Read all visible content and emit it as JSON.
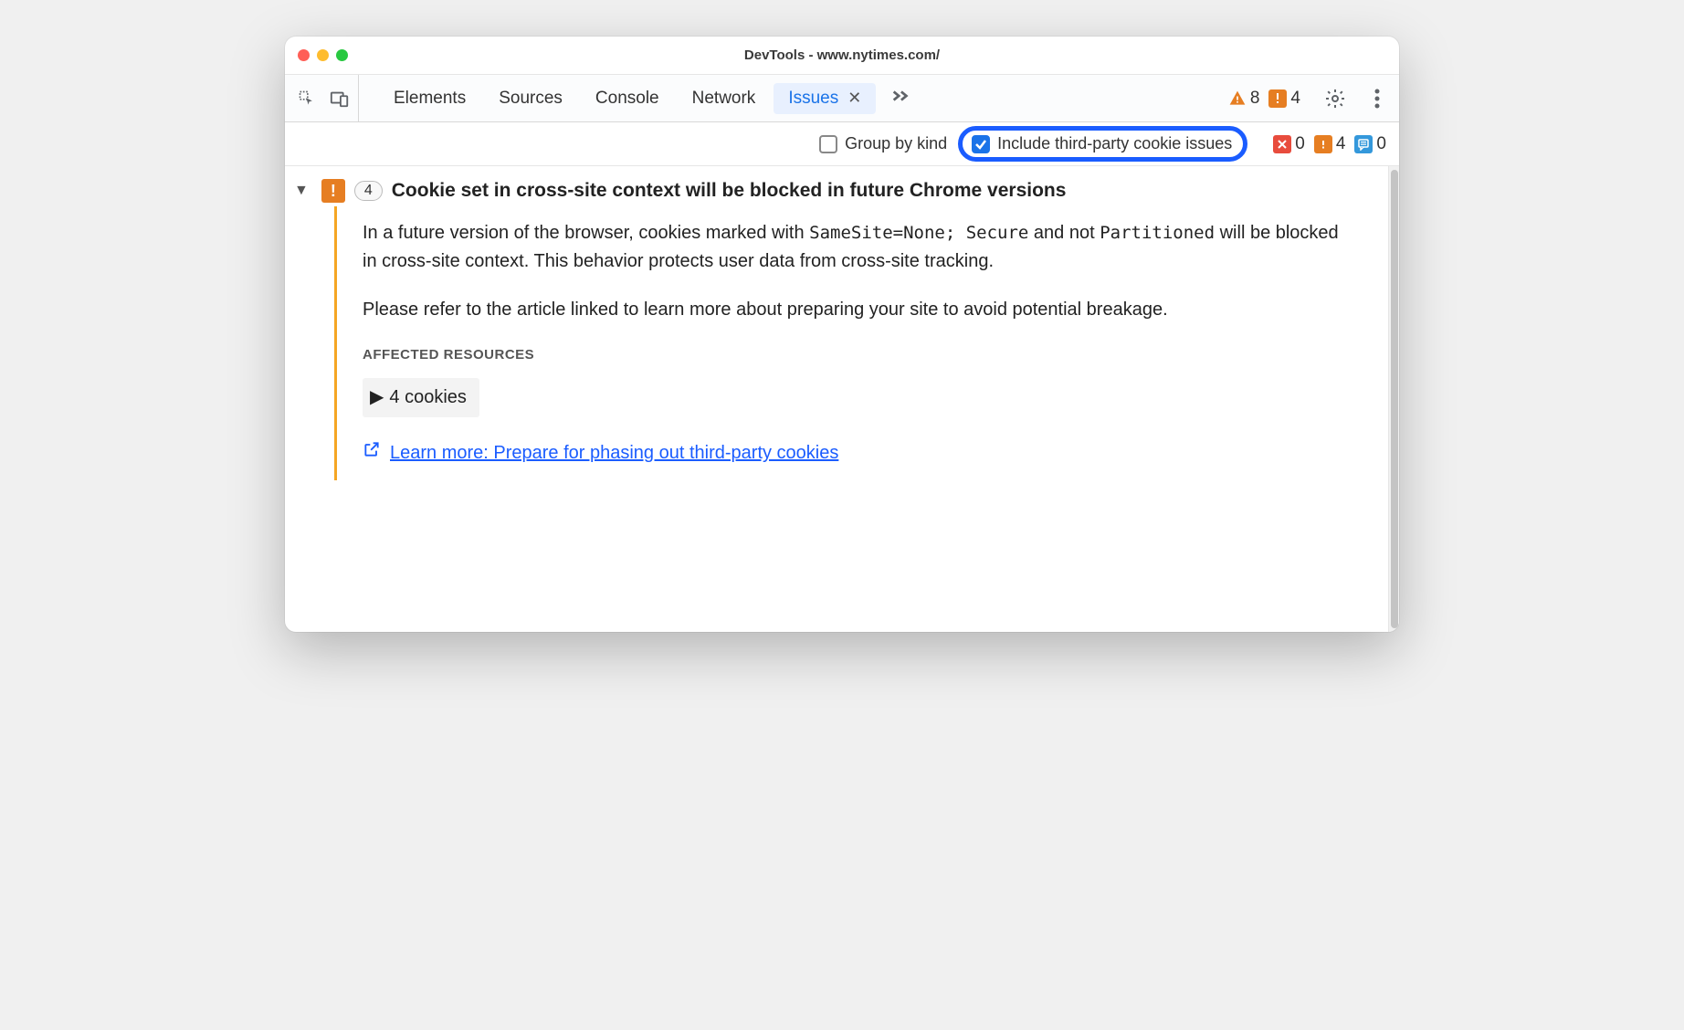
{
  "window": {
    "title": "DevTools - www.nytimes.com/"
  },
  "tabs": {
    "items": [
      "Elements",
      "Sources",
      "Console",
      "Network",
      "Issues"
    ],
    "active": "Issues"
  },
  "status": {
    "warning_count": "8",
    "issue_count": "4"
  },
  "filter": {
    "group_by_kind_label": "Group by kind",
    "include_tp_label": "Include third-party cookie issues"
  },
  "issue_counts": {
    "errors": "0",
    "warnings": "4",
    "info": "0"
  },
  "issue": {
    "count": "4",
    "title": "Cookie set in cross-site context will be blocked in future Chrome versions",
    "body_p1_pre": "In a future version of the browser, cookies marked with ",
    "body_p1_code1": "SameSite=None; Secure",
    "body_p1_mid": " and not ",
    "body_p1_code2": "Partitioned",
    "body_p1_post": " will be blocked in cross-site context. This behavior protects user data from cross-site tracking.",
    "body_p2": "Please refer to the article linked to learn more about preparing your site to avoid potential breakage.",
    "affected_label": "AFFECTED RESOURCES",
    "cookies_label": "4 cookies",
    "learn_more": "Learn more: Prepare for phasing out third-party cookies"
  }
}
